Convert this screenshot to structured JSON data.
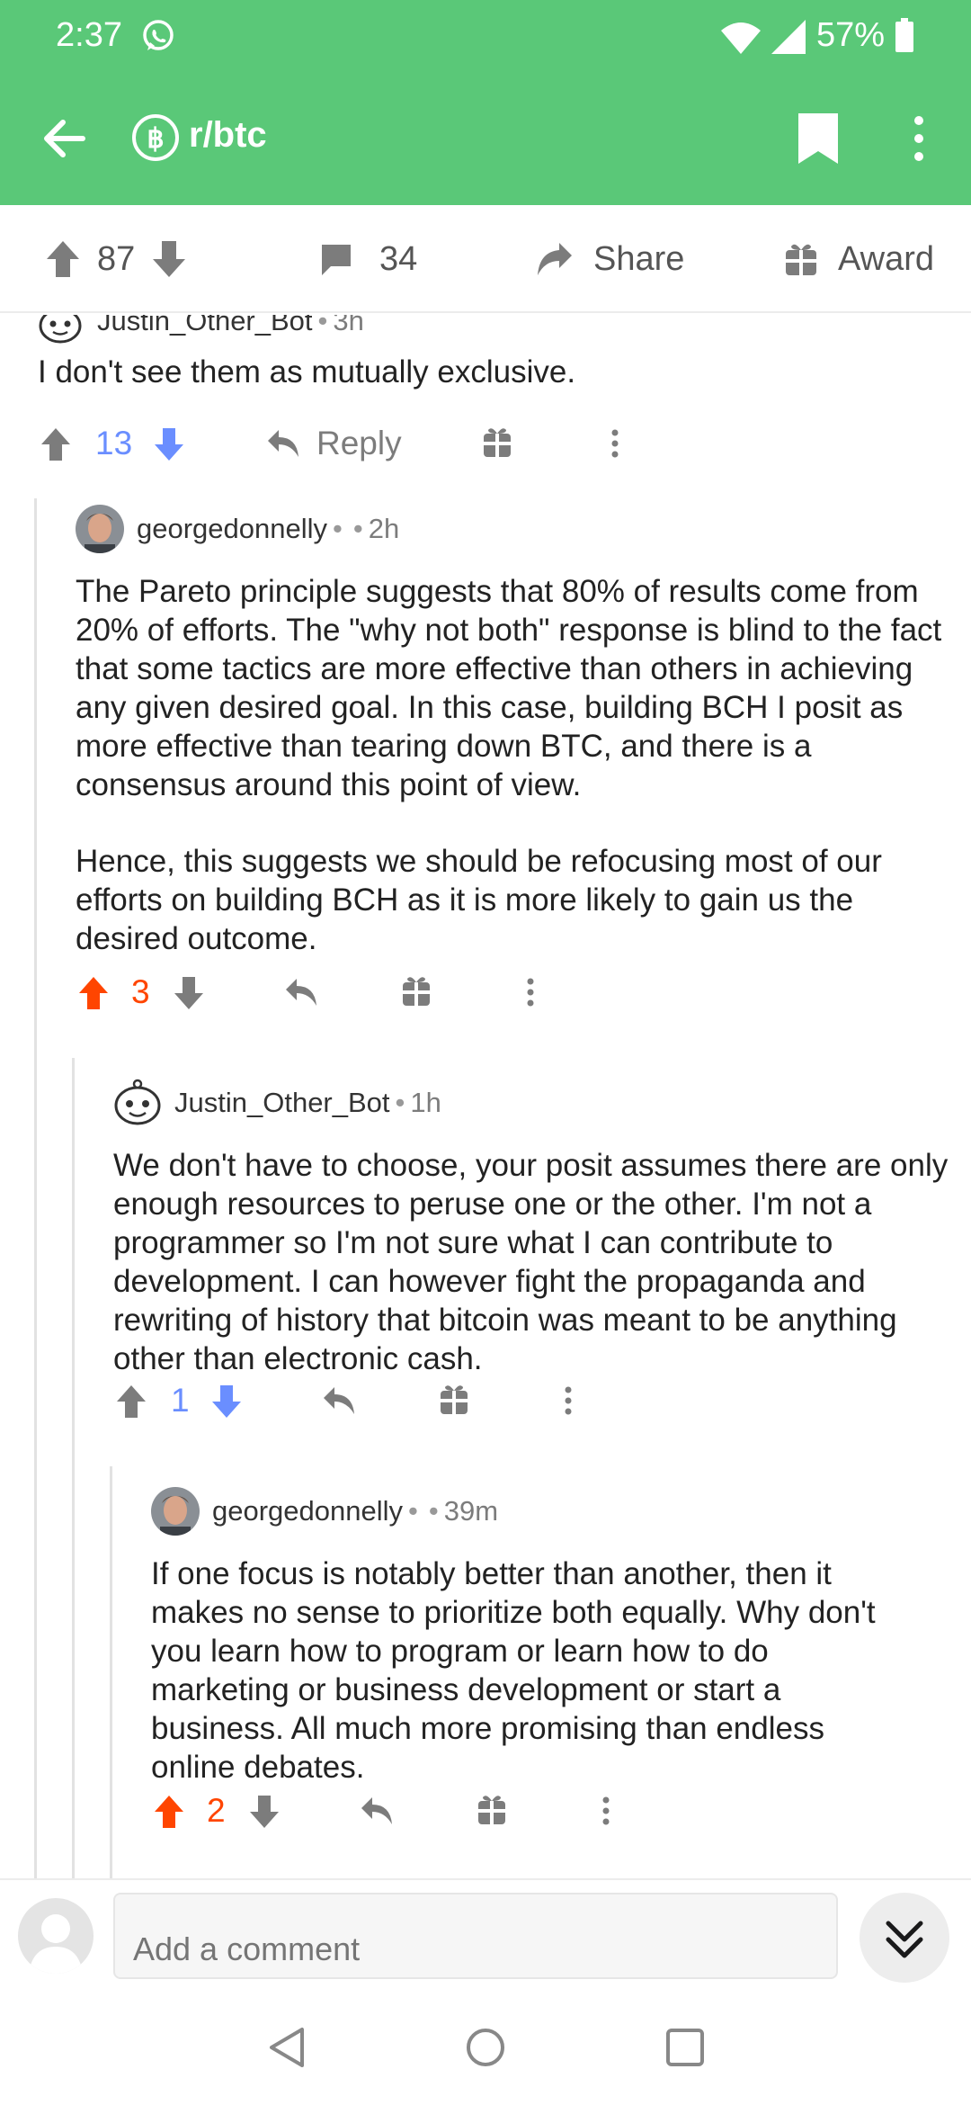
{
  "status_bar": {
    "time": "2:37",
    "battery": "57%"
  },
  "app_bar": {
    "subreddit": "r/btc",
    "sub_icon": "bitcoin-icon"
  },
  "post_actions": {
    "score": "87",
    "comments": "34",
    "share_label": "Share",
    "award_label": "Award"
  },
  "colors": {
    "header_green": "#5ac878",
    "upvote_orange": "#ff4500",
    "downvote_blue": "#6a8eff",
    "muted": "#7c7c7c"
  },
  "comments": [
    {
      "author": "Justin_Other_Bot",
      "time": "3h",
      "paragraphs": [
        "I don't see them as mutually exclusive."
      ],
      "score": "13",
      "vote": "down",
      "reply_label": "Reply"
    },
    {
      "author": "georgedonnelly",
      "time": "2h",
      "paragraphs": [
        "The Pareto principle suggests that 80% of results come from 20% of efforts. The \"why not both\" response is blind to the fact that some tactics are more effective than others in achieving any given desired goal. In this case, building BCH I posit as more effective than tearing down BTC, and there is a consensus around this point of view.",
        "Hence, this suggests we should be refocusing most of our efforts on building BCH as it is more likely to gain us the desired outcome."
      ],
      "score": "3",
      "vote": "up"
    },
    {
      "author": "Justin_Other_Bot",
      "time": "1h",
      "paragraphs": [
        "We don't have to choose, your posit assumes there are only enough resources to peruse one or the other. I'm not a programmer so I'm not sure what I can contribute to development. I can however fight the propaganda and rewriting of history that bitcoin was meant to be anything other than electronic cash."
      ],
      "score": "1",
      "vote": "down"
    },
    {
      "author": "georgedonnelly",
      "time": "39m",
      "paragraphs": [
        "If one focus is notably better than another, then it makes no sense to prioritize both equally. Why don't you learn how to program or learn how to do marketing or business development or start a business. All much more promising than endless online debates."
      ],
      "score": "2",
      "vote": "up"
    }
  ],
  "comment_bar": {
    "placeholder": "Add a comment"
  }
}
